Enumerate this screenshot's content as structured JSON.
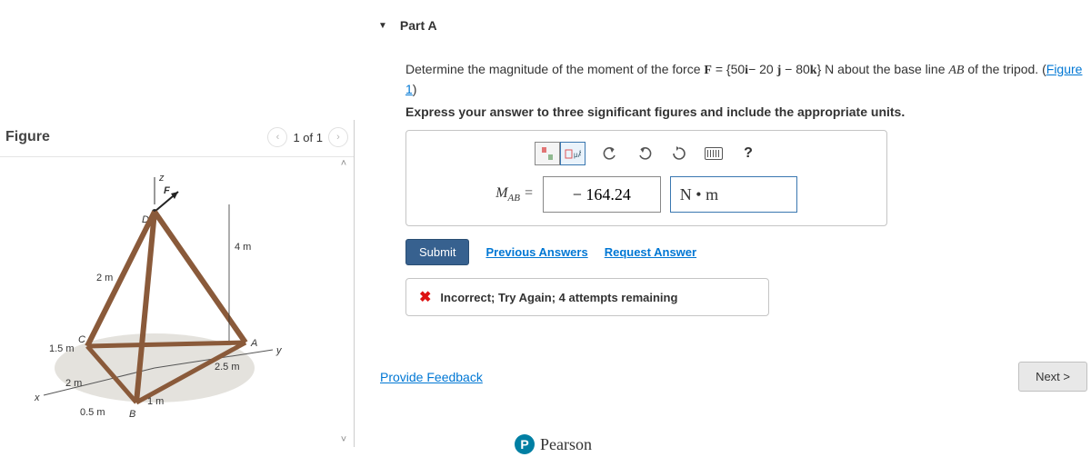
{
  "figure": {
    "title": "Figure",
    "counter": "1 of 1",
    "labels": {
      "z": "z",
      "y": "y",
      "x": "x",
      "F": "F",
      "D": "D",
      "C": "C",
      "A": "A",
      "B": "B",
      "h": "4 m",
      "cd": "2 m",
      "xa": "1.5 m",
      "xb": "2 m",
      "ob": "0.5 m",
      "oa": "2.5 m",
      "ba": "1 m"
    }
  },
  "part": {
    "header": "Part A",
    "question_pre": "Determine the magnitude of the moment of the force ",
    "force_sym": "F",
    "force_eq": " = {50",
    "i": "i",
    "force_mid1": "− 20 ",
    "j": "j",
    "force_mid2": " − 80",
    "k": "k",
    "force_end": "} N about the base line ",
    "ab": "AB",
    "question_post": " of the tripod. (",
    "fig_link": "Figure 1",
    "close_paren": ")",
    "instruction": "Express your answer to three significant figures and include the appropriate units."
  },
  "answer": {
    "label_html": "M",
    "label_sub": "AB",
    "equals": "=",
    "value": "− 164.24",
    "units": "N • m"
  },
  "actions": {
    "submit": "Submit",
    "previous": "Previous Answers",
    "request": "Request Answer"
  },
  "feedback": {
    "text": "Incorrect; Try Again; 4 attempts remaining"
  },
  "bottom": {
    "provide": "Provide Feedback",
    "next": "Next >"
  },
  "footer": {
    "p": "P",
    "brand": "Pearson"
  },
  "tool": {
    "help": "?"
  }
}
